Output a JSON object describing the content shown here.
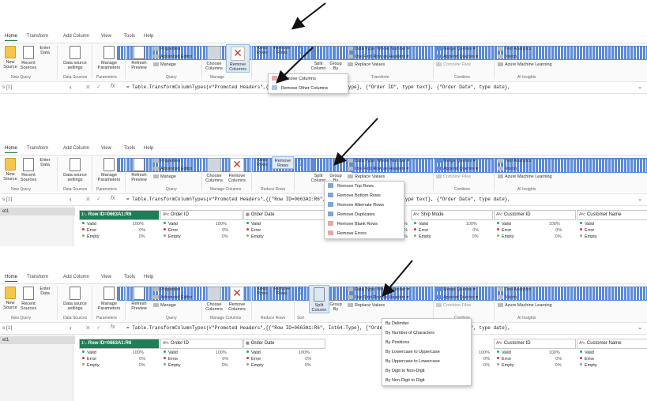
{
  "ribbon": {
    "tabs": [
      "Home",
      "Transform",
      "Add Column",
      "View",
      "Tools",
      "Help"
    ],
    "new_source": "New Source",
    "recent_sources": "Recent Sources",
    "enter_data": "Enter Data",
    "data_source_settings": "Data source settings",
    "manage_parameters": "Manage Parameters",
    "refresh_preview": "Refresh Preview",
    "properties": "Properties",
    "advanced_editor": "Advanced Editor",
    "manage": "Manage",
    "choose_columns": "Choose Columns",
    "remove_columns": "Remove Columns",
    "keep_rows": "Keep Rows",
    "remove_rows": "Remove Rows",
    "split_column": "Split Column",
    "group_by": "Group By",
    "data_type": "Data Type: Whole Number",
    "use_first_row": "Use First Row as Headers",
    "replace_values": "Replace Values",
    "merge_queries": "Merge Queries",
    "append_queries": "Append Queries",
    "combine_files": "Combine Files",
    "text_analytics": "Text Analytics",
    "vision": "Vision",
    "azure_ml": "Azure Machine Learning",
    "groups": {
      "new_query": "New Query",
      "data_sources": "Data Sources",
      "parameters": "Parameters",
      "query": "Query",
      "manage_columns": "Manage Columns",
      "reduce_rows": "Reduce Rows",
      "sort": "Sort",
      "transform": "Transform",
      "combine": "Combine",
      "ai_insights": "AI Insights"
    }
  },
  "panel1": {
    "group_manage_label": "Manage",
    "formula": "= Table.TransformColumnTypes(#\"Promoted Headers\",{{\"Row ID=0663A1:R6\", Int64.Type}, {\"Order ID\", type text}, {\"Order Date\", type date},",
    "menu": [
      "Remove Columns",
      "Remove Other Columns"
    ]
  },
  "panel2": {
    "formula": "= Table.TransformColumnTypes(#\"Promoted Headers\",{{\"Row ID=0663A1:R6\", Int64.Type}, {\"Order ID\", type text}, {\"Order Date\", type date},",
    "menu": [
      "Remove Top Rows",
      "Remove Bottom Rows",
      "Remove Alternate Rows",
      "Remove Duplicates",
      "Remove Blank Rows",
      "Remove Errors"
    ]
  },
  "panel3": {
    "formula": "= Table.TransformColumnTypes(#\"Promoted Headers\",{{\"Row ID=0663A1:R6\", Int64.Type}, {\"Order ID\", type text}, {\"Order Date\", type date},",
    "menu": [
      "By Delimiter",
      "By Number of Characters",
      "By Positions",
      "By Lowercase to Uppercase",
      "By Uppercase to Lowercase",
      "By Digit to Non-Digit",
      "By Non-Digit to Digit"
    ]
  },
  "query_list": {
    "name": "s [1]",
    "item": "et1"
  },
  "columns": [
    "Row ID=0663A1:R6",
    "Order ID",
    "Order Date",
    "Ship Date",
    "Ship Mode",
    "Customer ID",
    "Customer Name"
  ],
  "quality": {
    "labels": [
      "Valid",
      "Error",
      "Empty"
    ],
    "values": [
      "100%",
      "0%",
      "0%"
    ]
  },
  "colors": {
    "accent": "#217346",
    "header_green": "#1e7e59",
    "valid": "#19a974",
    "error": "#d9342b"
  }
}
